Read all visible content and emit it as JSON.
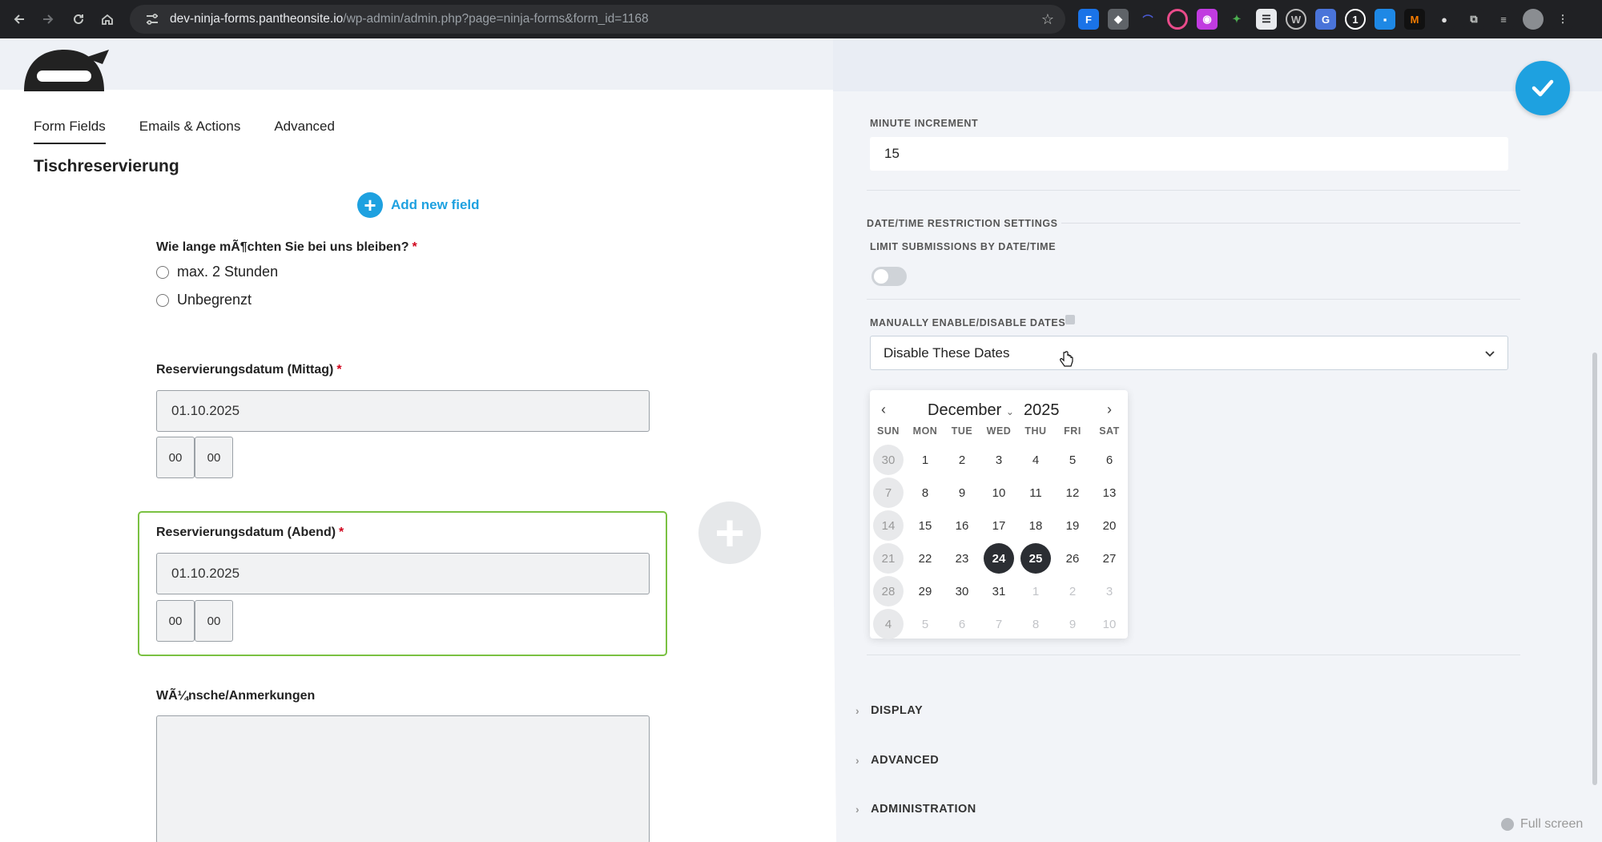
{
  "browser": {
    "url_host": "dev-ninja-forms.pantheonsite.io",
    "url_path": "/wp-admin/admin.php?page=ninja-forms&form_id=1168"
  },
  "tabs": [
    {
      "label": "Form Fields",
      "active": true
    },
    {
      "label": "Emails & Actions",
      "active": false
    },
    {
      "label": "Advanced",
      "active": false
    }
  ],
  "form": {
    "title": "Tischreservierung",
    "add_new_field": "Add new field",
    "fields": {
      "stay": {
        "label": "Wie lange mÃ¶chten Sie bei uns bleiben?",
        "required_mark": "*",
        "options": [
          "max. 2 Stunden",
          "Unbegrenzt"
        ]
      },
      "date_lunch": {
        "label": "Reservierungsdatum (Mittag)",
        "required_mark": "*",
        "value": "01.10.2025",
        "hour": "00",
        "minute": "00"
      },
      "date_evening": {
        "label": "Reservierungsdatum (Abend)",
        "required_mark": "*",
        "value": "01.10.2025",
        "hour": "00",
        "minute": "00"
      },
      "notes": {
        "label": "WÃ¼nsche/Anmerkungen"
      }
    }
  },
  "drawer": {
    "minute_increment_label": "MINUTE INCREMENT",
    "minute_increment_value": "15",
    "restriction_heading": "DATE/TIME RESTRICTION SETTINGS",
    "limit_label": "LIMIT SUBMISSIONS BY DATE/TIME",
    "limit_enabled": false,
    "manual_label": "MANUALLY ENABLE/DISABLE DATES",
    "manual_value": "Disable These Dates",
    "calendar": {
      "month": "December",
      "year": "2025",
      "weekdays": [
        "SUN",
        "MON",
        "TUE",
        "WED",
        "THU",
        "FRI",
        "SAT"
      ],
      "weeks": [
        [
          "30",
          "1",
          "2",
          "3",
          "4",
          "5",
          "6"
        ],
        [
          "7",
          "8",
          "9",
          "10",
          "11",
          "12",
          "13"
        ],
        [
          "14",
          "15",
          "16",
          "17",
          "18",
          "19",
          "20"
        ],
        [
          "21",
          "22",
          "23",
          "24",
          "25",
          "26",
          "27"
        ],
        [
          "28",
          "29",
          "30",
          "31",
          "1",
          "2",
          "3"
        ],
        [
          "4",
          "5",
          "6",
          "7",
          "8",
          "9",
          "10"
        ]
      ],
      "selected": [
        "24",
        "25"
      ]
    },
    "sections": [
      "DISPLAY",
      "ADVANCED",
      "ADMINISTRATION"
    ],
    "fullscreen_label": "Full screen"
  },
  "colors": {
    "accent": "#1ea1e0",
    "active_border": "#7ac142",
    "required": "#d0021b"
  }
}
